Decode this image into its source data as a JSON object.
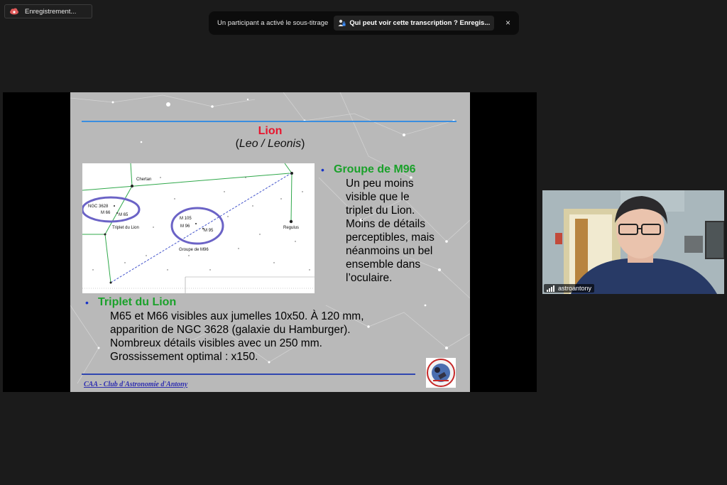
{
  "recording": {
    "label": "Enregistrement..."
  },
  "banner": {
    "message": "Un participant a activé le sous-titrage",
    "link": "Qui peut voir cette transcription ? Enregis...",
    "close": "×"
  },
  "slide": {
    "title": "Lion",
    "subtitle_open": "(",
    "subtitle_it": "Leo / Leonis",
    "subtitle_close": ")",
    "chart_labels": {
      "chertan": "Chertan",
      "ngc3628": "NGC 3628",
      "m66": "M 66",
      "m65": "M 65",
      "triplet": "Triplet du Lion",
      "m105": "M 105",
      "m96": "M 96",
      "m95": "M 95",
      "groupe": "Groupe de M96",
      "regulus": "Regulus"
    },
    "groupe": {
      "heading": "Groupe de M96",
      "lines": [
        "Un peu moins",
        "visible que le",
        "triplet du Lion.",
        "Moins de détails",
        "perceptibles, mais",
        "néanmoins un bel",
        "ensemble dans",
        "l’oculaire."
      ]
    },
    "triplet": {
      "heading": "Triplet du Lion",
      "lines": [
        "M65 et M66 visibles aux jumelles 10x50. À 120 mm,",
        "apparition de NGC 3628 (galaxie du Hamburger).",
        "Nombreux détails visibles avec un 250 mm.",
        "Grossissement optimal : x150."
      ]
    },
    "footer": "CAA - Club d'Astronomie d'Antony",
    "bullet": "•"
  },
  "video": {
    "name": "astroantony"
  }
}
